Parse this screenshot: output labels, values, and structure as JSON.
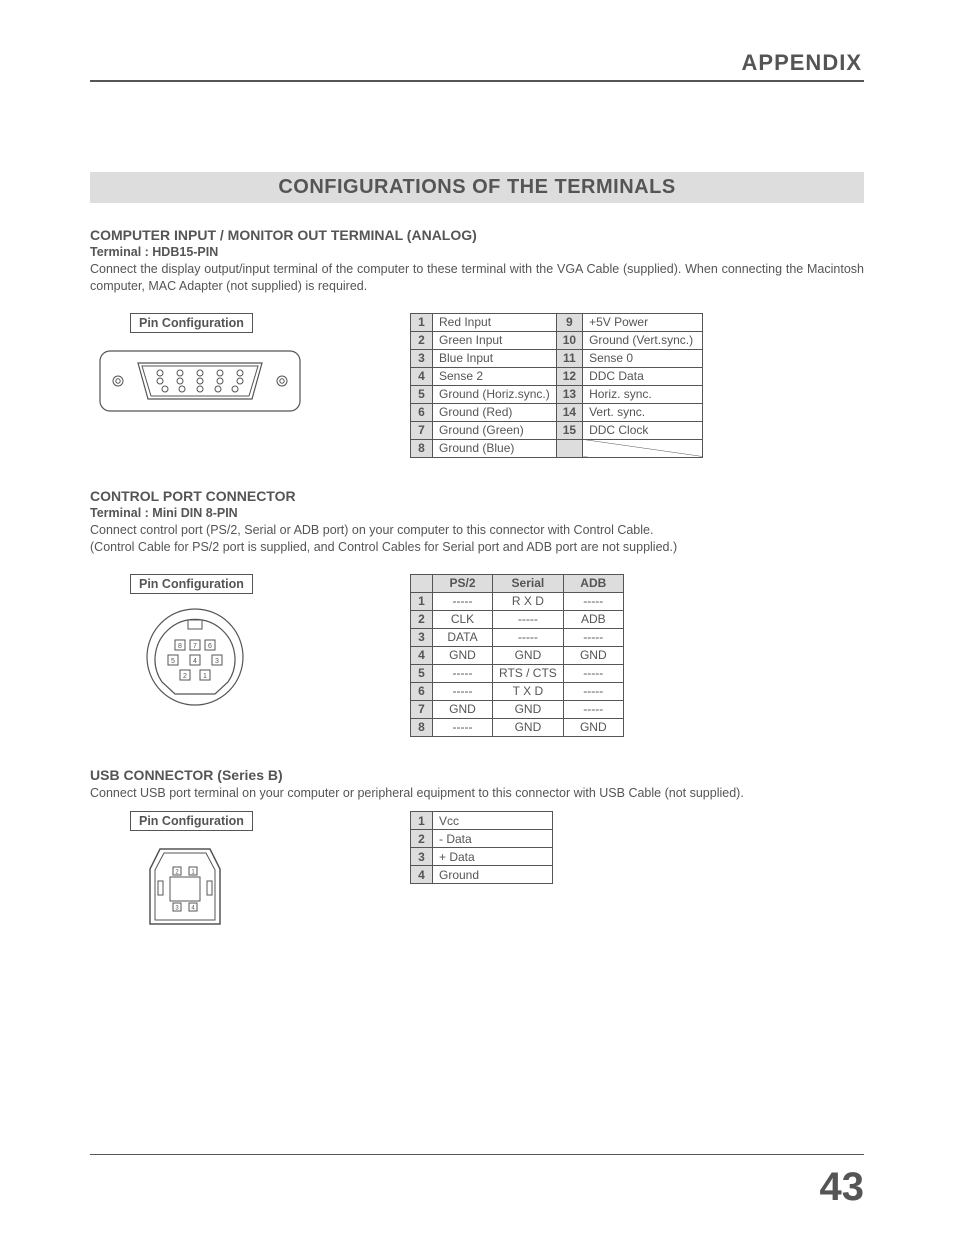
{
  "header": {
    "title": "APPENDIX"
  },
  "main_title": "CONFIGURATIONS OF THE TERMINALS",
  "section1": {
    "title": "COMPUTER INPUT / MONITOR OUT TERMINAL (ANALOG)",
    "subtitle": "Terminal : HDB15-PIN",
    "body": "Connect the display output/input terminal of the computer to these terminal with the VGA Cable (supplied).  When connecting the Macintosh computer, MAC Adapter (not supplied) is required.",
    "pin_label": "Pin Configuration",
    "pins_left": [
      {
        "n": "1",
        "d": "Red Input"
      },
      {
        "n": "2",
        "d": "Green Input"
      },
      {
        "n": "3",
        "d": "Blue Input"
      },
      {
        "n": "4",
        "d": "Sense 2"
      },
      {
        "n": "5",
        "d": "Ground (Horiz.sync.)"
      },
      {
        "n": "6",
        "d": "Ground (Red)"
      },
      {
        "n": "7",
        "d": "Ground (Green)"
      },
      {
        "n": "8",
        "d": "Ground (Blue)"
      }
    ],
    "pins_right": [
      {
        "n": "9",
        "d": "+5V Power"
      },
      {
        "n": "10",
        "d": "Ground (Vert.sync.)"
      },
      {
        "n": "11",
        "d": "Sense 0"
      },
      {
        "n": "12",
        "d": "DDC Data"
      },
      {
        "n": "13",
        "d": "Horiz. sync."
      },
      {
        "n": "14",
        "d": "Vert. sync."
      },
      {
        "n": "15",
        "d": "DDC Clock"
      }
    ]
  },
  "section2": {
    "title": "CONTROL PORT CONNECTOR",
    "subtitle": "Terminal : Mini DIN 8-PIN",
    "body1": "Connect control port (PS/2, Serial or ADB port) on your computer to this connector with Control Cable.",
    "body2": "(Control Cable for PS/2 port is supplied, and Control Cables for Serial port and ADB port are not supplied.)",
    "pin_label": "Pin Configuration",
    "headers": [
      "",
      "PS/2",
      "Serial",
      "ADB"
    ],
    "rows": [
      {
        "n": "1",
        "c": [
          "-----",
          "R X D",
          "-----"
        ]
      },
      {
        "n": "2",
        "c": [
          "CLK",
          "-----",
          "ADB"
        ]
      },
      {
        "n": "3",
        "c": [
          "DATA",
          "-----",
          "-----"
        ]
      },
      {
        "n": "4",
        "c": [
          "GND",
          "GND",
          "GND"
        ]
      },
      {
        "n": "5",
        "c": [
          "-----",
          "RTS / CTS",
          "-----"
        ]
      },
      {
        "n": "6",
        "c": [
          "-----",
          "T X D",
          "-----"
        ]
      },
      {
        "n": "7",
        "c": [
          "GND",
          "GND",
          "-----"
        ]
      },
      {
        "n": "8",
        "c": [
          "-----",
          "GND",
          "GND"
        ]
      }
    ]
  },
  "section3": {
    "title": "USB CONNECTOR (Series B)",
    "body": "Connect USB port terminal on your computer or peripheral equipment to this connector with USB Cable (not supplied).",
    "pin_label": "Pin Configuration",
    "rows": [
      {
        "n": "1",
        "d": "Vcc"
      },
      {
        "n": "2",
        "d": "- Data"
      },
      {
        "n": "3",
        "d": "+ Data"
      },
      {
        "n": "4",
        "d": "Ground"
      }
    ]
  },
  "page_number": "43"
}
